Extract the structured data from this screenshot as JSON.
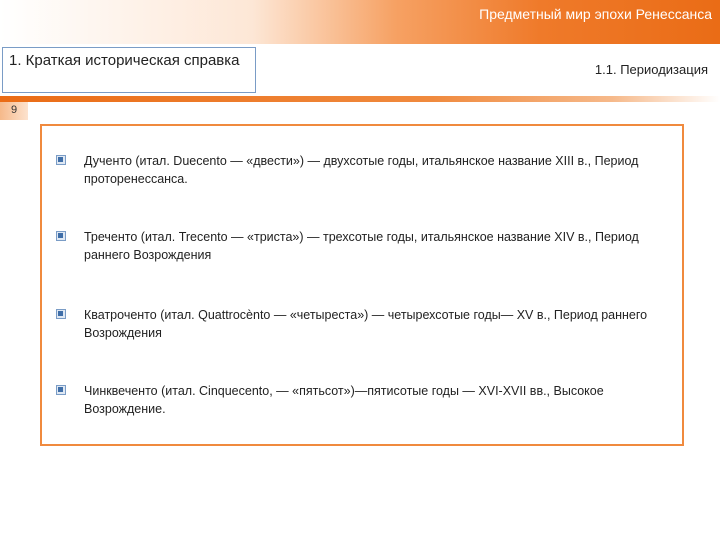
{
  "header": {
    "title": "Предметный мир эпохи Ренессанса"
  },
  "section": {
    "title": "1. Краткая историческая справка",
    "subtitle": "1.1. Периодизация",
    "page_number": "9"
  },
  "items": [
    {
      "text": "Дученто (итал. Duecento — «двести») — двухсотые годы, итальянское название XIII в., Период проторенессанса."
    },
    {
      "text": "Треченто (итал. Trecento — «триста») — трехсотые годы, итальянское название XIV в., Период раннего Возрождения"
    },
    {
      "text": "Кватроченто (итал. Quattrocènto — «четыреста») — четырехсотые годы— XV в., Период раннего Возрождения"
    },
    {
      "text": "Чинквеченто (итал. Cinquecento, — «пятьсот»)—пятисотые годы — XVI-XVII вв., Высокое Возрождение."
    }
  ],
  "colors": {
    "accent": "#ea6c16",
    "box_border": "#f08a3e",
    "section_border": "#7a9cc6"
  }
}
